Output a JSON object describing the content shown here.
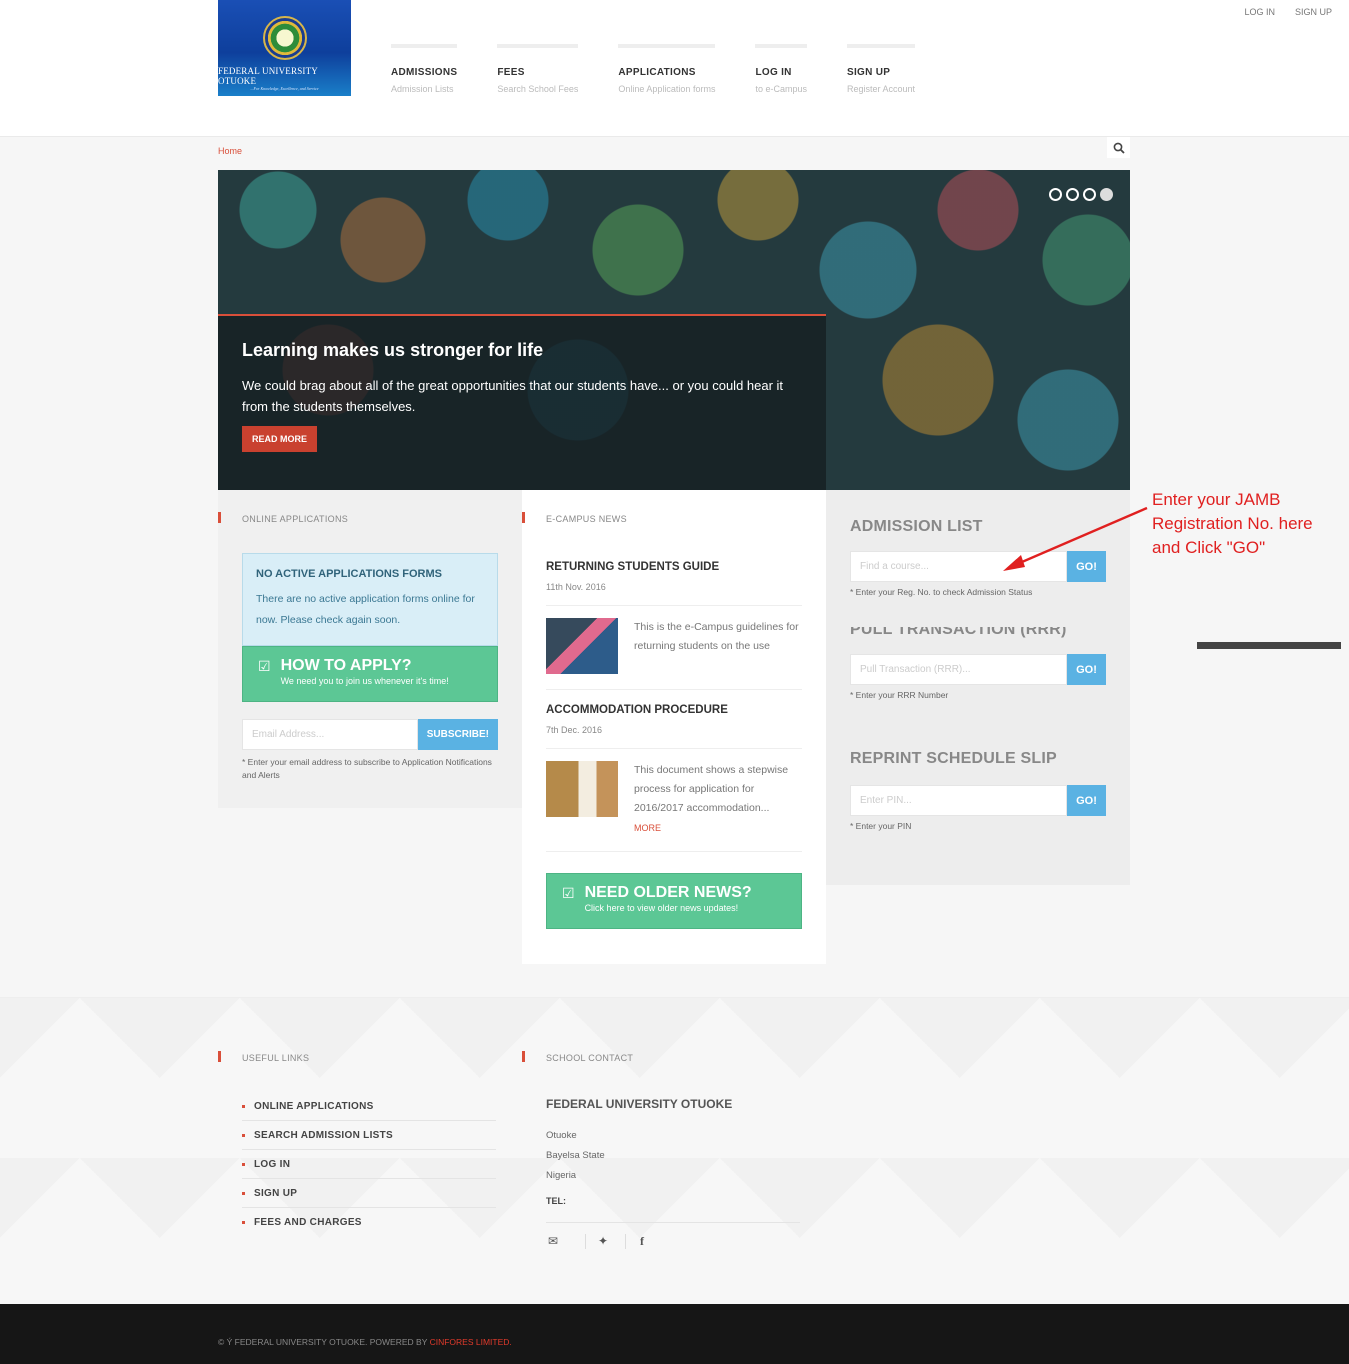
{
  "toplinks": {
    "login": "LOG IN",
    "signup": "SIGN UP"
  },
  "logo": {
    "name": "FEDERAL UNIVERSITY OTUOKE",
    "tagline": "...For Knowledge, Excellence, and Service"
  },
  "nav": [
    {
      "main": "ADMISSIONS",
      "sub": "Admission Lists"
    },
    {
      "main": "FEES",
      "sub": "Search School Fees"
    },
    {
      "main": "APPLICATIONS",
      "sub": "Online Application forms"
    },
    {
      "main": "LOG IN",
      "sub": "to e-Campus"
    },
    {
      "main": "SIGN UP",
      "sub": "Register Account"
    }
  ],
  "breadcrumb": "Home",
  "hero": {
    "title": "Learning makes us stronger for life",
    "text": "We could brag about all of the great opportunities that our students have... or you could hear it from the students themselves.",
    "button": "READ MORE",
    "active_slide": 4,
    "slide_count": 4
  },
  "col1": {
    "title": "ONLINE APPLICATIONS",
    "info_title": "NO ACTIVE APPLICATIONS FORMS",
    "info_text": "There are no active application forms online for now. Please check again soon.",
    "apply_big": "HOW TO APPLY?",
    "apply_small": "We need you to join us whenever it's time!",
    "email_placeholder": "Email Address...",
    "subscribe": "SUBSCRIBE!",
    "note": "* Enter your email address to subscribe to Application Notifications and Alerts"
  },
  "col2": {
    "title": "E-CAMPUS NEWS",
    "news": [
      {
        "title": "RETURNING STUDENTS GUIDE",
        "date": "11th Nov. 2016",
        "text": "This is the e-Campus guidelines for returning students on the use"
      },
      {
        "title": "ACCOMMODATION PROCEDURE",
        "date": "7th Dec. 2016",
        "text": "This document shows a stepwise process for application for 2016/2017 accommodation...",
        "more": "MORE"
      }
    ],
    "older_big": "NEED OLDER NEWS?",
    "older_small": "Click here to view older news updates!"
  },
  "col3": {
    "admission": {
      "title": "ADMISSION LIST",
      "placeholder": "Find a course...",
      "go": "GO!",
      "note": "* Enter your Reg. No. to check Admission Status"
    },
    "transaction": {
      "title": "PULL TRANSACTION (RRR)",
      "placeholder": "Pull Transaction (RRR)...",
      "go": "GO!",
      "note": "* Enter your RRR Number"
    },
    "reprint": {
      "title": "REPRINT SCHEDULE SLIP",
      "placeholder": "Enter PIN...",
      "go": "GO!",
      "note": "* Enter your PIN"
    }
  },
  "annotation": {
    "line1": "Enter your JAMB",
    "line2": "Registration No. here",
    "line3": "and Click \"GO\"",
    "color": "#e02020"
  },
  "footer": {
    "links_title": "USEFUL LINKS",
    "links": [
      "ONLINE APPLICATIONS",
      "SEARCH ADMISSION LISTS",
      "LOG IN",
      "SIGN UP",
      "FEES AND CHARGES"
    ],
    "contact_title": "SCHOOL CONTACT",
    "contact_name": "FEDERAL UNIVERSITY OTUOKE",
    "address": [
      "Otuoke",
      "Bayelsa State",
      "Nigeria"
    ],
    "tel_label": "TEL:",
    "copyright": "© Ý FEDERAL UNIVERSITY OTUOKE. POWERED BY ",
    "powered_by": "CINFORES LIMITED."
  },
  "colors": {
    "accent": "#d94f3a",
    "button_blue": "#5ab2e3",
    "green": "#5cc795"
  }
}
